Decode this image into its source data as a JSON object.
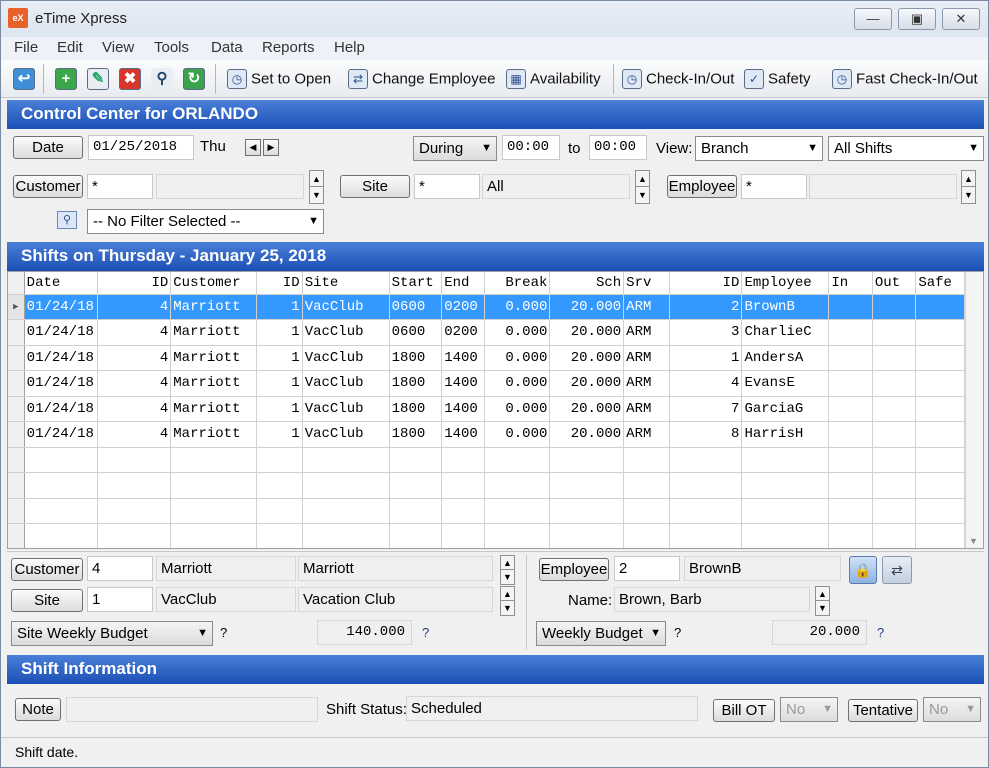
{
  "window": {
    "title": "eTime Xpress",
    "icon_text": "eX"
  },
  "menu": [
    "File",
    "Edit",
    "View",
    "Tools",
    "Data",
    "Reports",
    "Help"
  ],
  "toolbar": {
    "set_to_open": "Set to Open",
    "change_employee": "Change Employee",
    "availability": "Availability",
    "check_in_out": "Check-In/Out",
    "safety": "Safety",
    "fast_check_in_out": "Fast Check-In/Out"
  },
  "control_center": {
    "title": "Control Center for ORLANDO",
    "date_label": "Date",
    "date_value": "01/25/2018",
    "day": "Thu",
    "during": "During",
    "time_from": "00:00",
    "to_label": "to",
    "time_to": "00:00",
    "view_label": "View:",
    "view_value": "Branch",
    "shifts_filter": "All Shifts",
    "customer_label": "Customer",
    "customer_value": "*",
    "site_label": "Site",
    "site_value": "*",
    "site_name": "All",
    "employee_label": "Employee",
    "employee_value": "*",
    "filter_value": "-- No Filter Selected --"
  },
  "shifts": {
    "title": "Shifts on Thursday - January 25, 2018",
    "columns": [
      "Date",
      "ID",
      "Customer",
      "ID",
      "Site",
      "Start",
      "End",
      "Break",
      "Sch",
      "Srv",
      "ID",
      "Employee",
      "In",
      "Out",
      "Safe"
    ],
    "rows": [
      [
        "01/24/18",
        "4",
        "Marriott",
        "1",
        "VacClub",
        "0600",
        "0200",
        "0.000",
        "20.000",
        "ARM",
        "2",
        "BrownB",
        "",
        "",
        ""
      ],
      [
        "01/24/18",
        "4",
        "Marriott",
        "1",
        "VacClub",
        "0600",
        "0200",
        "0.000",
        "20.000",
        "ARM",
        "3",
        "CharlieC",
        "",
        "",
        ""
      ],
      [
        "01/24/18",
        "4",
        "Marriott",
        "1",
        "VacClub",
        "1800",
        "1400",
        "0.000",
        "20.000",
        "ARM",
        "1",
        "AndersA",
        "",
        "",
        ""
      ],
      [
        "01/24/18",
        "4",
        "Marriott",
        "1",
        "VacClub",
        "1800",
        "1400",
        "0.000",
        "20.000",
        "ARM",
        "4",
        "EvansE",
        "",
        "",
        ""
      ],
      [
        "01/24/18",
        "4",
        "Marriott",
        "1",
        "VacClub",
        "1800",
        "1400",
        "0.000",
        "20.000",
        "ARM",
        "7",
        "GarciaG",
        "",
        "",
        ""
      ],
      [
        "01/24/18",
        "4",
        "Marriott",
        "1",
        "VacClub",
        "1800",
        "1400",
        "0.000",
        "20.000",
        "ARM",
        "8",
        "HarrisH",
        "",
        "",
        ""
      ]
    ],
    "selected_row": 0
  },
  "detail": {
    "customer_label": "Customer",
    "customer_id": "4",
    "customer_code": "Marriott",
    "customer_name": "Marriott",
    "site_label": "Site",
    "site_id": "1",
    "site_code": "VacClub",
    "site_name": "Vacation Club",
    "site_budget_label": "Site Weekly Budget",
    "site_budget_q": "?",
    "site_budget_value": "140.000",
    "site_budget_q2": "?",
    "employee_label": "Employee",
    "employee_id": "2",
    "employee_code": "BrownB",
    "name_label": "Name:",
    "employee_name": "Brown, Barb",
    "emp_budget_label": "Weekly Budget",
    "emp_budget_q": "?",
    "emp_budget_value": "20.000",
    "emp_budget_q2": "?"
  },
  "shift_info": {
    "title": "Shift Information",
    "note_label": "Note",
    "note_value": "",
    "status_label": "Shift Status:",
    "status_value": "Scheduled",
    "bill_ot_label": "Bill OT",
    "bill_ot_value": "No",
    "tentative_label": "Tentative",
    "tentative_value": "No"
  },
  "status_bar": "Shift date.",
  "colors": {
    "header_blue": "#1c4fb5",
    "selection": "#3399ff",
    "app_icon": "#e8602a"
  }
}
